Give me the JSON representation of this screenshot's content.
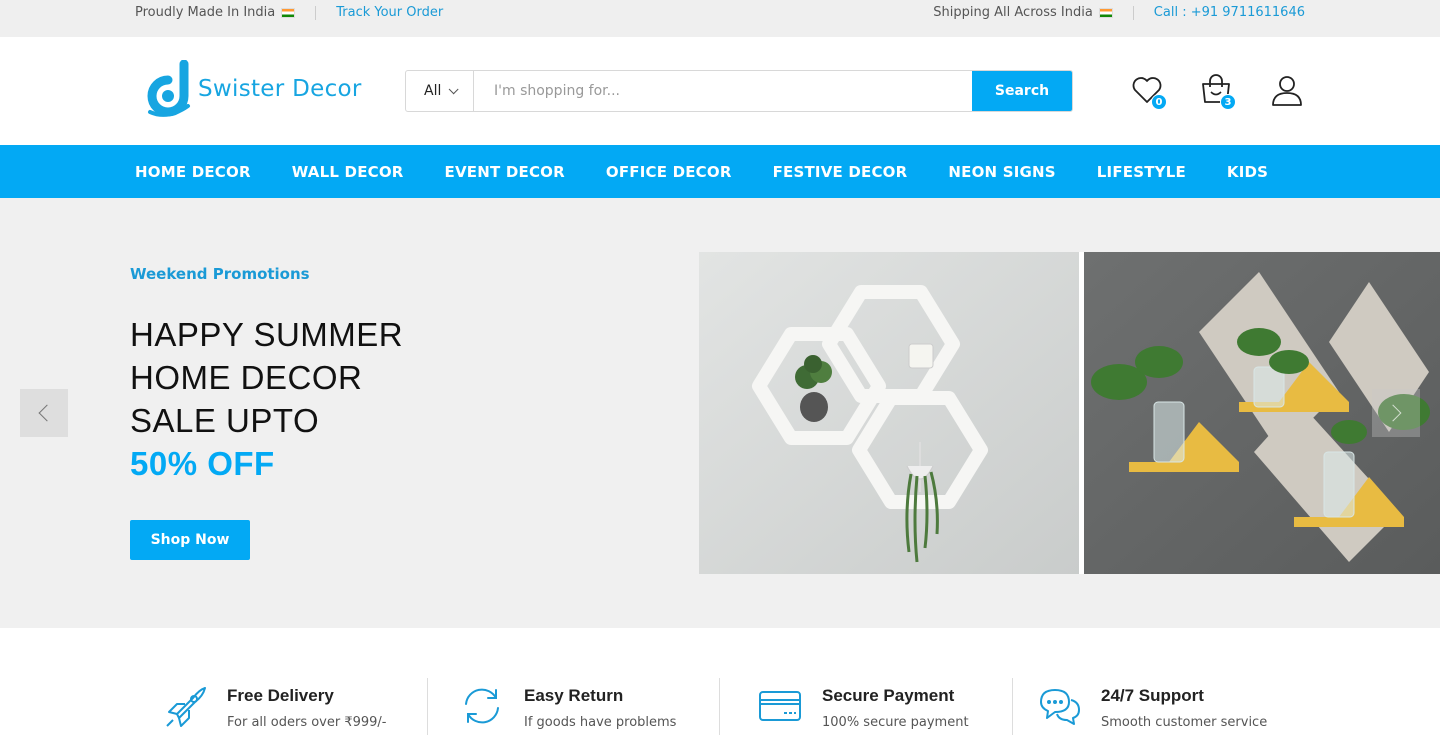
{
  "topbar": {
    "left_text": "Proudly Made In India",
    "track_order": "Track Your Order",
    "shipping_text": "Shipping All Across India",
    "call_text": "Call : +91 9711611646"
  },
  "header": {
    "logo_text": "Swister Decor",
    "search": {
      "category": "All",
      "placeholder": "I'm shopping for...",
      "button_label": "Search"
    },
    "wishlist_count": "0",
    "cart_count": "3"
  },
  "nav": {
    "items": [
      "HOME DECOR",
      "WALL DECOR",
      "EVENT DECOR",
      "OFFICE DECOR",
      "FESTIVE DECOR",
      "NEON SIGNS",
      "LIFESTYLE",
      "KIDS"
    ]
  },
  "hero": {
    "label": "Weekend Promotions",
    "line1": "HAPPY SUMMER",
    "line2": "HOME DECOR",
    "line3": "SALE UPTO",
    "accent": "50% OFF",
    "button_label": "Shop Now"
  },
  "features": [
    {
      "title": "Free Delivery",
      "subtitle": "For all oders over ₹999/-",
      "icon": "rocket-icon"
    },
    {
      "title": "Easy Return",
      "subtitle": "If goods have problems",
      "icon": "refresh-icon"
    },
    {
      "title": "Secure Payment",
      "subtitle": "100% secure payment",
      "icon": "credit-card-icon"
    },
    {
      "title": "24/7 Support",
      "subtitle": "Smooth customer service",
      "icon": "chat-icon"
    }
  ],
  "colors": {
    "accent": "#03a9f4",
    "topbar_bg": "#efefef",
    "hero_bg": "#f0f0f0"
  }
}
